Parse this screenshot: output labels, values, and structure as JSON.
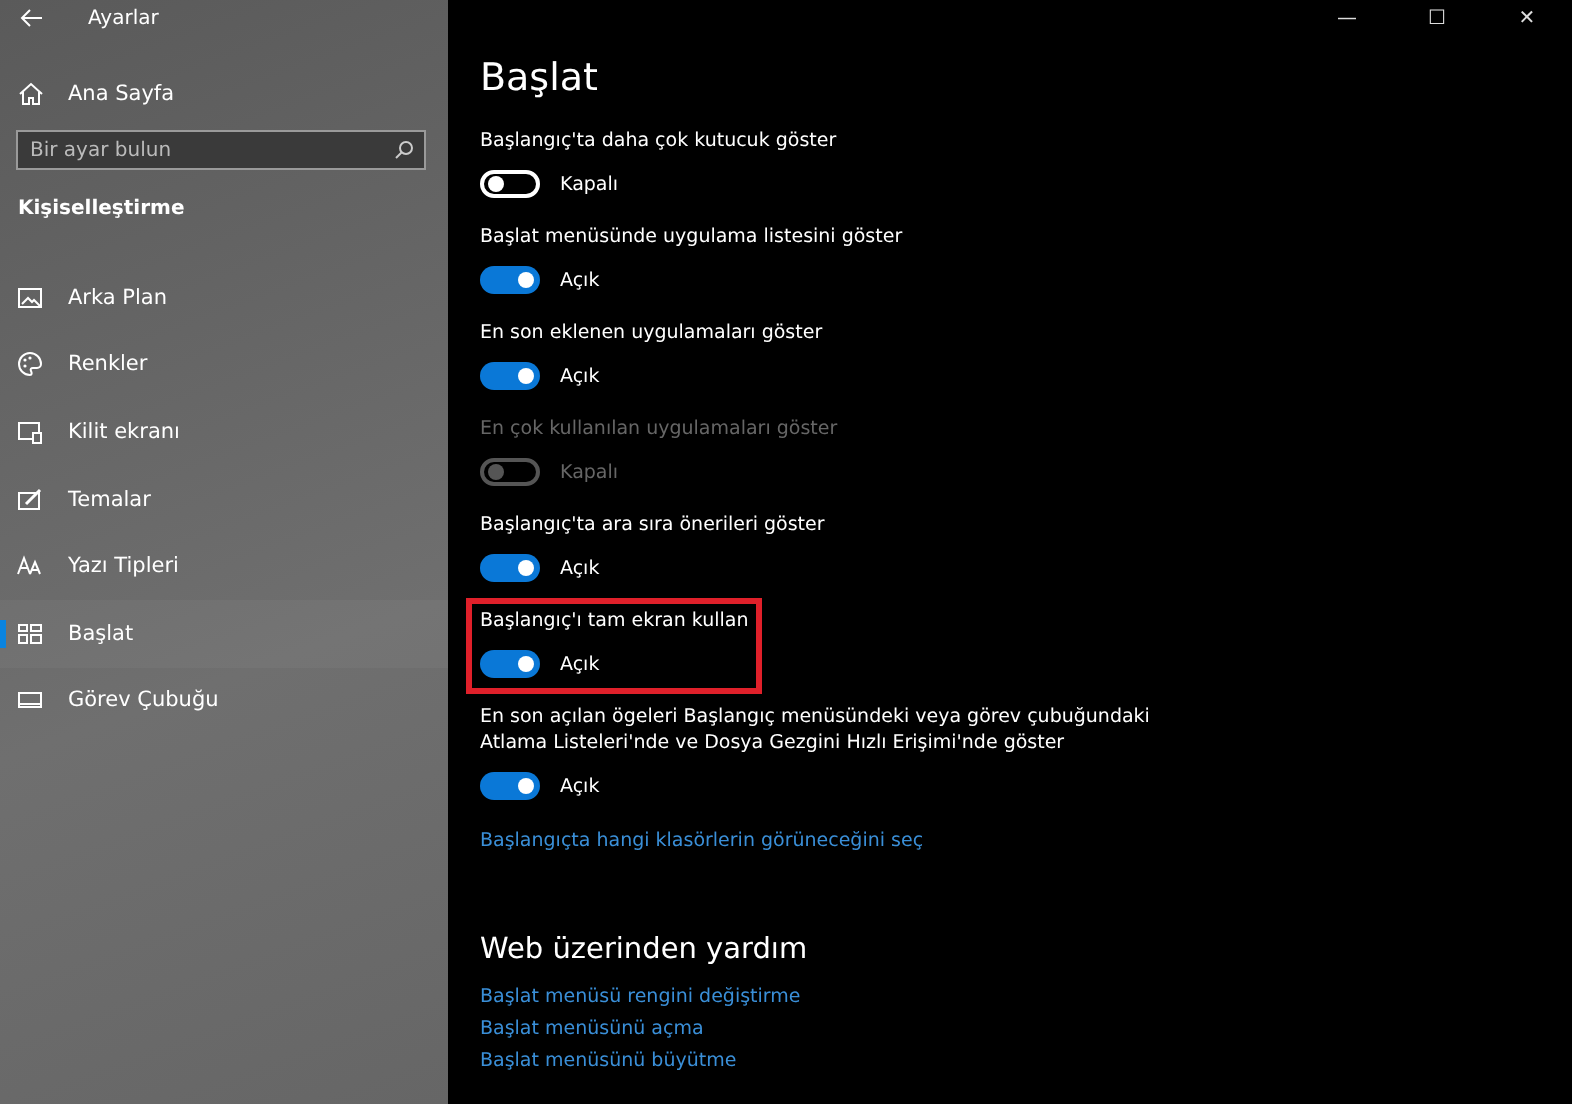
{
  "window": {
    "title": "Ayarlar",
    "controls": [
      "—",
      "☐",
      "✕"
    ]
  },
  "sidebar": {
    "home": "Ana Sayfa",
    "search": {
      "placeholder": "Bir ayar bulun"
    },
    "section": "Kişiselleştirme",
    "items": [
      {
        "label": "Arka Plan",
        "selected": false
      },
      {
        "label": "Renkler",
        "selected": false
      },
      {
        "label": "Kilit ekranı",
        "selected": false
      },
      {
        "label": "Temalar",
        "selected": false
      },
      {
        "label": "Yazı Tipleri",
        "selected": false
      },
      {
        "label": "Başlat",
        "selected": true
      },
      {
        "label": "Görev Çubuğu",
        "selected": false
      }
    ]
  },
  "page": {
    "title": "Başlat",
    "settings": [
      {
        "label": "Başlangıç'ta daha çok kutucuk göster",
        "on": false,
        "disabled": false,
        "highlighted": false,
        "state_label": "Kapalı"
      },
      {
        "label": "Başlat menüsünde uygulama listesini göster",
        "on": true,
        "disabled": false,
        "highlighted": false,
        "state_label": "Açık"
      },
      {
        "label": "En son eklenen uygulamaları göster",
        "on": true,
        "disabled": false,
        "highlighted": false,
        "state_label": "Açık"
      },
      {
        "label": "En çok kullanılan uygulamaları göster",
        "on": false,
        "disabled": true,
        "highlighted": false,
        "state_label": "Kapalı"
      },
      {
        "label": "Başlangıç'ta ara sıra önerileri göster",
        "on": true,
        "disabled": false,
        "highlighted": false,
        "state_label": "Açık"
      },
      {
        "label": "Başlangıç'ı tam ekran kullan",
        "on": true,
        "disabled": false,
        "highlighted": true,
        "state_label": "Açık"
      },
      {
        "label": "En son açılan ögeleri Başlangıç menüsündeki veya görev çubuğundaki Atlama Listeleri'nde ve Dosya Gezgini Hızlı Erişimi'nde göster",
        "on": true,
        "disabled": false,
        "highlighted": false,
        "state_label": "Açık"
      }
    ],
    "folders_link": "Başlangıçta hangi klasörlerin görüneceğini seç",
    "help": {
      "title": "Web üzerinden yardım",
      "links": [
        "Başlat menüsü rengini değiştirme",
        "Başlat menüsünü açma",
        "Başlat menüsünü büyütme"
      ]
    }
  }
}
